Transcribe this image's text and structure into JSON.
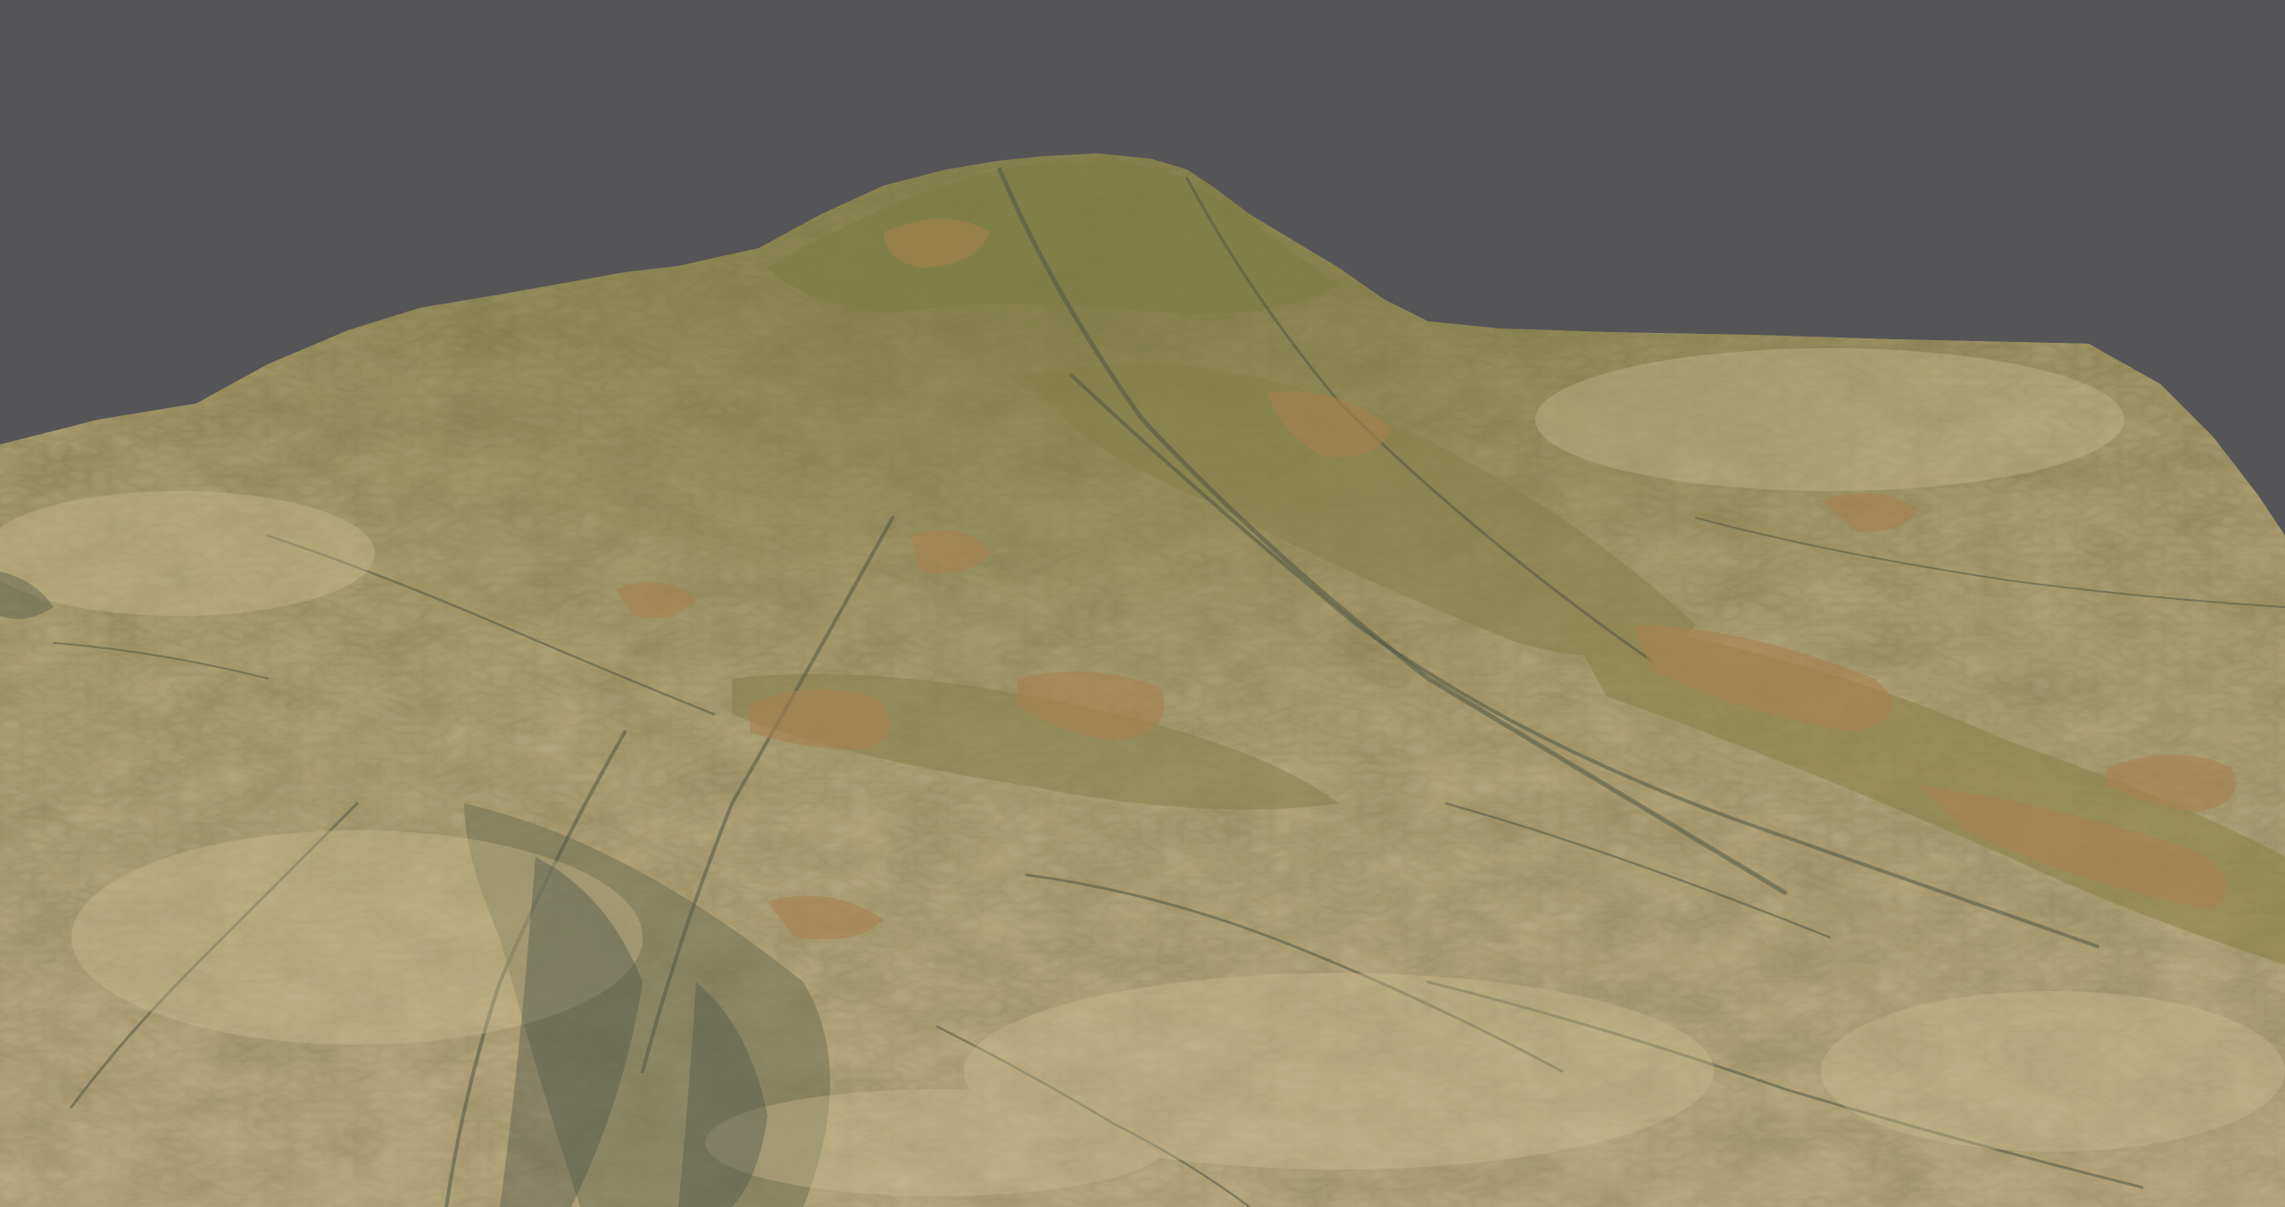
{
  "scene": {
    "background_color": "#555457",
    "terrain": {
      "base_color": "#a89a6e",
      "highlight_color": "#c4b48a",
      "vegetation_color": "#7d7f45",
      "rock_color": "#a9814f",
      "shadow_color": "#5f6a55"
    }
  }
}
